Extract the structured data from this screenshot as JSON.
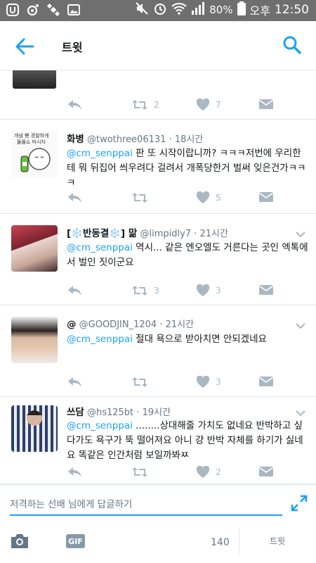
{
  "status_bar": {
    "battery": "80%",
    "ampm": "오후",
    "time": "12:50"
  },
  "header": {
    "title": "트윗"
  },
  "partial_tweet": {
    "retweets": "2",
    "likes": "7"
  },
  "tweets": [
    {
      "name": "화병",
      "handle": "@twothree06131",
      "time": "· 18시간",
      "mention": "@cm_senppai",
      "text": " 판 또 시작이랍니까? ㅋㅋㅋ저번에 우리한테 뭐 뒤집어 씌우려다 걸려서 개폭당한거 벌써 잊은건가ㅋㅋㅋ",
      "retweets": "",
      "likes": "5",
      "avatar_caption": "개념 뻗 경찰하게 뚫뚫쇼 마시자"
    },
    {
      "name": "[❄️반동결❄️] 맒",
      "handle": "@limpidly7",
      "time": "· 21시간",
      "mention": "@cm_senppai",
      "text": " 역시... 같은 엔오엘도 거른다는 곳인 엑톡에서 벌인 짓이군요",
      "retweets": "3",
      "likes": "3"
    },
    {
      "name": "@",
      "handle": "@GOODJIN_1204",
      "time": "· 21시간",
      "mention": "@cm_senppai",
      "text": " 절대 욕으로 받아치면 안되겠네요",
      "retweets": "",
      "likes": "3"
    },
    {
      "name": "쓰담",
      "handle": "@hs125bt",
      "time": "· 19시간",
      "mention": "@cm_senppai",
      "text": " ........상대해줄 가치도 없네요 반박하고 싶다가도 욕구가 뚝 떨어져요 아니 걍 반박 자체를 하기가 싫네요 똑같은 인간처럼 보일까봐ㅉ",
      "retweets": "",
      "likes": "2"
    }
  ],
  "reply": {
    "placeholder": "저격하는 선배 님에게 답글하기",
    "gif_label": "GIF",
    "char_count": "140",
    "tweet_button": "트윗"
  },
  "colors": {
    "accent": "#1da1f2",
    "icon_gray": "#aab8c2",
    "status_bar": "#6f6f6f"
  }
}
